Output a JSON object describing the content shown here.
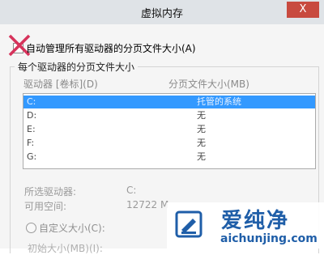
{
  "window": {
    "title": "虚拟内存",
    "close_symbol": "X"
  },
  "auto_manage": {
    "label": "自动管理所有驱动器的分页文件大小(A)",
    "checked": false
  },
  "paging_group": {
    "title": "每个驱动器的分页文件大小",
    "columns": [
      "驱动器 [卷标](D)",
      "分页文件大小(MB)"
    ],
    "rows": [
      {
        "drive": "C:",
        "size": "托管的系统",
        "selected": true
      },
      {
        "drive": "D:",
        "size": "无",
        "selected": false
      },
      {
        "drive": "E:",
        "size": "无",
        "selected": false
      },
      {
        "drive": "F:",
        "size": "无",
        "selected": false
      },
      {
        "drive": "G:",
        "size": "无",
        "selected": false
      }
    ]
  },
  "info": {
    "selected_drive_label": "所选驱动器:",
    "selected_drive_value": "C:",
    "free_space_label": "可用空间:",
    "free_space_value": "12722 M"
  },
  "custom": {
    "label": "自定义大小(C):",
    "initial_size_label": "初始大小(MB)(I):"
  },
  "watermark": {
    "logo_icon": "aichunjing-logo-icon",
    "text": "爱纯净",
    "url": "aichunjing.com",
    "color": "#1f5ea8"
  },
  "colors": {
    "selection": "#3399ff",
    "title_bar": "#dfe3e7",
    "close_button": "#c84a3f",
    "cross_mark": "#d6335b"
  }
}
